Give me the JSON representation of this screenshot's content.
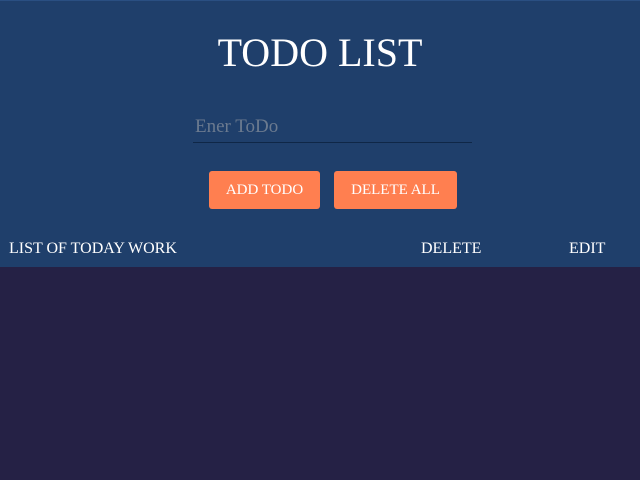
{
  "header": {
    "title": "TODO LIST"
  },
  "input": {
    "placeholder": "Ener ToDo",
    "value": ""
  },
  "buttons": {
    "add_label": "ADD TODO",
    "delete_all_label": "DELETE ALL"
  },
  "list": {
    "columns": {
      "work": "LIST OF TODAY WORK",
      "delete": "DELETE",
      "edit": "EDIT"
    },
    "items": []
  },
  "colors": {
    "header_bg": "#1f3f6b",
    "page_bg": "#252145",
    "accent": "#ff7f50",
    "text": "#ffffff",
    "placeholder": "#6b7a8f"
  }
}
